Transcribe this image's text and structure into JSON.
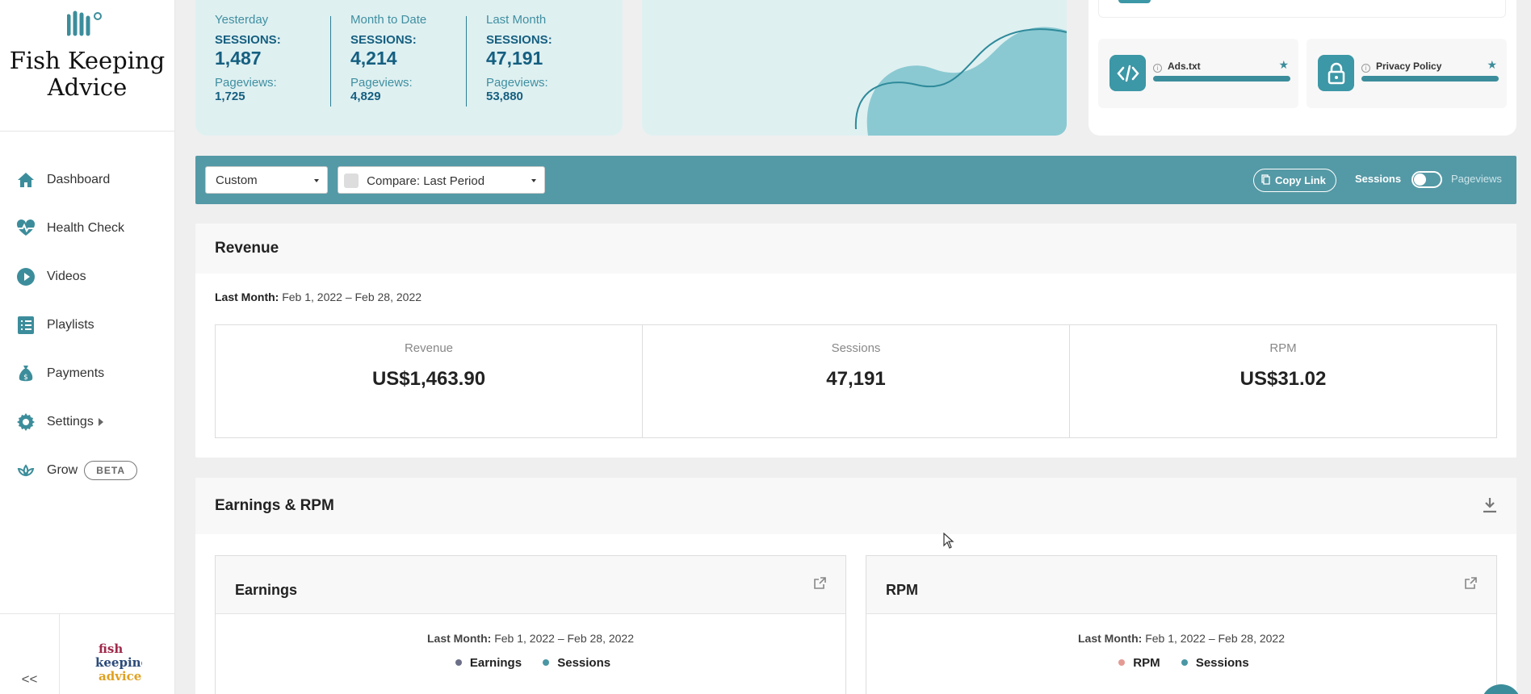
{
  "sidebar": {
    "site_name": "Fish Keeping Advice",
    "items": [
      {
        "label": "Dashboard",
        "icon": "home-icon"
      },
      {
        "label": "Health Check",
        "icon": "heartbeat-icon"
      },
      {
        "label": "Videos",
        "icon": "play-icon"
      },
      {
        "label": "Playlists",
        "icon": "list-icon"
      },
      {
        "label": "Payments",
        "icon": "money-bag-icon"
      },
      {
        "label": "Settings",
        "icon": "gear-icon"
      },
      {
        "label": "Grow",
        "icon": "lotus-icon",
        "badge": "BETA"
      }
    ],
    "collapse_label": "<<",
    "small_logo": "fish keeping advice"
  },
  "stats": [
    {
      "period": "Yesterday",
      "sessions_label": "SESSIONS:",
      "sessions": "1,487",
      "pageviews_label": "Pageviews:",
      "pageviews": "1,725"
    },
    {
      "period": "Month to Date",
      "sessions_label": "SESSIONS:",
      "sessions": "4,214",
      "pageviews_label": "Pageviews:",
      "pageviews": "4,829"
    },
    {
      "period": "Last Month",
      "sessions_label": "SESSIONS:",
      "sessions": "47,191",
      "pageviews_label": "Pageviews:",
      "pageviews": "53,880"
    }
  ],
  "tools": [
    {
      "name": "Ads.txt",
      "icon": "code-icon"
    },
    {
      "name": "Privacy Policy",
      "icon": "lock-icon"
    }
  ],
  "filter": {
    "range": "Custom",
    "compare": "Compare: Last Period",
    "copy_link": "Copy Link",
    "toggle_left": "Sessions",
    "toggle_right": "Pageviews"
  },
  "revenue": {
    "title": "Revenue",
    "date_label": "Last Month:",
    "date_range": "Feb 1, 2022 – Feb 28, 2022",
    "metrics": [
      {
        "label": "Revenue",
        "value": "US$1,463.90"
      },
      {
        "label": "Sessions",
        "value": "47,191"
      },
      {
        "label": "RPM",
        "value": "US$31.02"
      }
    ]
  },
  "earnings_rpm": {
    "title": "Earnings & RPM",
    "cards": [
      {
        "title": "Earnings",
        "date_label": "Last Month:",
        "date_range": "Feb 1, 2022 – Feb 28, 2022",
        "legend": [
          {
            "label": "Earnings",
            "color": "#6b6f87"
          },
          {
            "label": "Sessions",
            "color": "#4a96a4"
          }
        ]
      },
      {
        "title": "RPM",
        "date_label": "Last Month:",
        "date_range": "Feb 1, 2022 – Feb 28, 2022",
        "legend": [
          {
            "label": "RPM",
            "color": "#e49a93"
          },
          {
            "label": "Sessions",
            "color": "#4a96a4"
          }
        ]
      }
    ]
  },
  "colors": {
    "accent": "#5499a6",
    "brand_dark": "#155f80"
  }
}
